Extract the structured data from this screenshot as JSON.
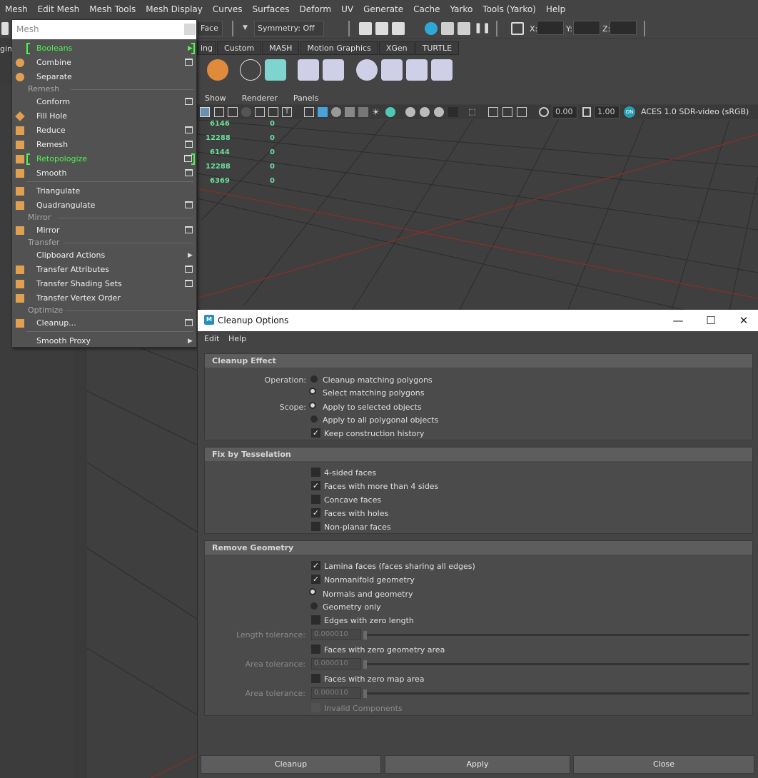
{
  "menubar": [
    "Mesh",
    "Edit Mesh",
    "Mesh Tools",
    "Mesh Display",
    "Curves",
    "Surfaces",
    "Deform",
    "UV",
    "Generate",
    "Cache",
    "Yarko",
    "Tools (Yarko)",
    "Help"
  ],
  "statusline": {
    "mode_partial": "Face",
    "symmetry": "Symmetry: Off",
    "x_label": "X:",
    "y_label": "Y:",
    "z_label": "Z:"
  },
  "left_partial": {
    "label": "gin"
  },
  "shelf": {
    "partial_tab": "ing",
    "tabs": [
      "Custom",
      "MASH",
      "Motion Graphics",
      "XGen",
      "TURTLE"
    ]
  },
  "viewport": {
    "menu": [
      "Show",
      "Renderer",
      "Panels"
    ],
    "exposure": "0.00",
    "gamma": "1.00",
    "colorspace": "ACES 1.0 SDR-video (sRGB)",
    "hud": [
      {
        "a": "6146",
        "b": "0"
      },
      {
        "a": "12288",
        "b": "0"
      },
      {
        "a": "6144",
        "b": "0"
      },
      {
        "a": "12288",
        "b": "0"
      },
      {
        "a": "6369",
        "b": "0"
      }
    ]
  },
  "mesh_menu": {
    "title": "Mesh",
    "booleans": "Booleans",
    "combine": "Combine",
    "separate": "Separate",
    "remesh_header": "Remesh",
    "conform": "Conform",
    "fill_hole": "Fill Hole",
    "reduce": "Reduce",
    "remesh": "Remesh",
    "retopologize": "Retopologize",
    "smooth": "Smooth",
    "triangulate": "Triangulate",
    "quadrangulate": "Quadrangulate",
    "mirror_header": "Mirror",
    "mirror": "Mirror",
    "transfer_header": "Transfer",
    "clipboard_actions": "Clipboard Actions",
    "transfer_attributes": "Transfer Attributes",
    "transfer_shading_sets": "Transfer Shading Sets",
    "transfer_vertex_order": "Transfer Vertex Order",
    "optimize_header": "Optimize",
    "cleanup": "Cleanup...",
    "smooth_proxy": "Smooth Proxy"
  },
  "dialog": {
    "title": "Cleanup Options",
    "menu_edit": "Edit",
    "menu_help": "Help",
    "cleanup_effect": {
      "header": "Cleanup Effect",
      "operation_label": "Operation:",
      "op_cleanup": "Cleanup matching polygons",
      "op_select": "Select matching polygons",
      "op_selected": "select",
      "scope_label": "Scope:",
      "scope_selected": "Apply to selected objects",
      "scope_all": "Apply to all polygonal objects",
      "scope_value": "selected",
      "keep_history": "Keep construction history",
      "keep_history_checked": true
    },
    "fix_by_tesselation": {
      "header": "Fix by Tesselation",
      "four_sided": "4-sided faces",
      "four_sided_checked": false,
      "more_than_4": "Faces with more than 4 sides",
      "more_than_4_checked": true,
      "concave": "Concave faces",
      "concave_checked": false,
      "holes": "Faces with holes",
      "holes_checked": true,
      "non_planar": "Non-planar faces",
      "non_planar_checked": false
    },
    "remove_geometry": {
      "header": "Remove Geometry",
      "lamina": "Lamina faces (faces sharing all edges)",
      "lamina_checked": true,
      "nonmanifold": "Nonmanifold geometry",
      "nonmanifold_checked": true,
      "normals_and_geometry": "Normals and geometry",
      "geometry_only": "Geometry only",
      "nonmanifold_mode": "normals_and_geometry",
      "zero_length_edges": "Edges with zero length",
      "zero_length_edges_checked": false,
      "length_tolerance_label": "Length tolerance:",
      "length_tolerance": "0.000010",
      "zero_geometry_area": "Faces with zero geometry area",
      "zero_geometry_area_checked": false,
      "area_tolerance_label": "Area tolerance:",
      "area_tolerance": "0.000010",
      "zero_map_area": "Faces with zero map area",
      "zero_map_area_checked": false,
      "map_area_tolerance_label": "Area tolerance:",
      "map_area_tolerance": "0.000010",
      "invalid_components": "Invalid Components",
      "invalid_components_checked": false
    },
    "buttons": {
      "cleanup": "Cleanup",
      "apply": "Apply",
      "close": "Close"
    }
  },
  "colors": {
    "accent_green": "#4df44d",
    "hud_green": "#6bdf9d",
    "grid_axis_red": "#9b2a22"
  }
}
